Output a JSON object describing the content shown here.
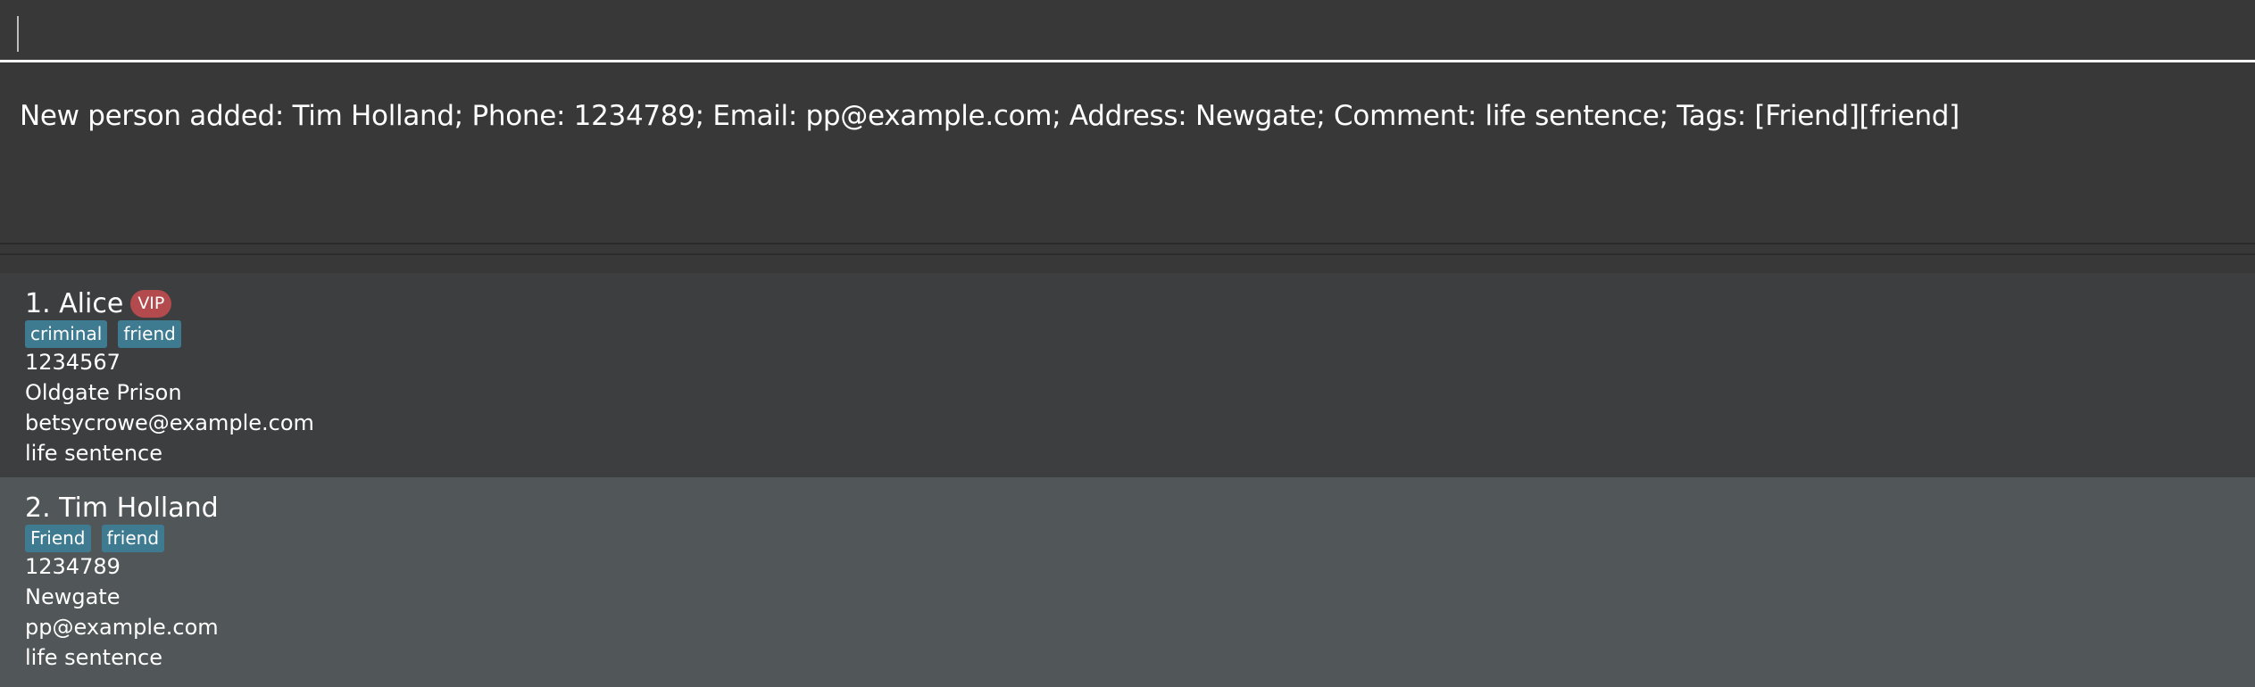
{
  "command_box": {
    "value": ""
  },
  "result_display": {
    "text": "New person added: Tim Holland; Phone: 1234789; Email: pp@example.com; Address: Newgate; Comment: life sentence; Tags: [Friend][friend]"
  },
  "persons": [
    {
      "name": "1. Alice",
      "badge": "VIP",
      "tags": [
        "criminal",
        "friend"
      ],
      "phone": "1234567",
      "address": "Oldgate Prison",
      "email": "betsycrowe@example.com",
      "comment": "life sentence",
      "selected": false
    },
    {
      "name": "2. Tim Holland",
      "tags": [
        "Friend",
        "friend"
      ],
      "phone": "1234789",
      "address": "Newgate",
      "email": "pp@example.com",
      "comment": "life sentence",
      "selected": true
    }
  ],
  "colors": {
    "background": "#383838",
    "card_default": "#3c3e3f",
    "card_selected": "#515658",
    "tag": "#3e7b91",
    "vip_badge": "#b34a4d",
    "text": "#ffffff"
  }
}
